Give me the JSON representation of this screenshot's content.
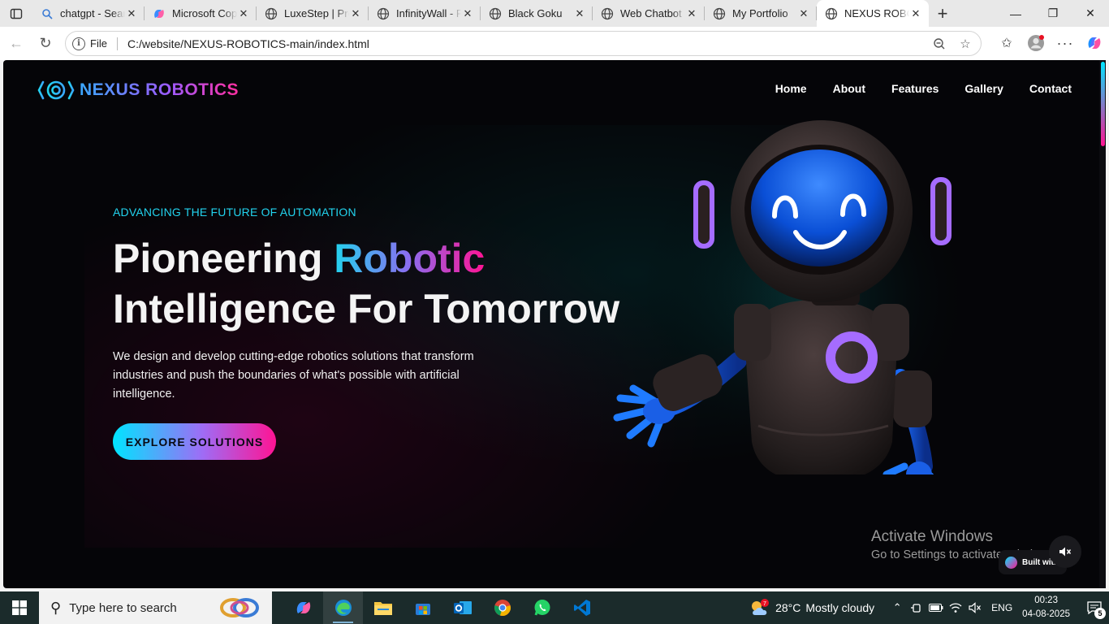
{
  "browser": {
    "tabs": [
      {
        "title": "chatgpt - Search",
        "icon": "search-favicon"
      },
      {
        "title": "Microsoft Copilot",
        "icon": "copilot-favicon"
      },
      {
        "title": "LuxeStep | Premium",
        "icon": "globe-favicon"
      },
      {
        "title": "InfinityWall - Premium",
        "icon": "globe-favicon"
      },
      {
        "title": "Black Goku",
        "icon": "globe-favicon"
      },
      {
        "title": "Web Chatbot",
        "icon": "globe-favicon"
      },
      {
        "title": "My Portfolio",
        "icon": "globe-favicon"
      },
      {
        "title": "NEXUS ROBOTICS",
        "icon": "globe-favicon",
        "active": true
      }
    ],
    "address": {
      "scheme_label": "File",
      "url": "C:/website/NEXUS-ROBOTICS-main/index.html"
    }
  },
  "site": {
    "brand": "NEXUS ROBOTICS",
    "nav": [
      "Home",
      "About",
      "Features",
      "Gallery",
      "Contact"
    ],
    "hero": {
      "eyebrow": "ADVANCING THE FUTURE OF AUTOMATION",
      "headline_part1": "Pioneering ",
      "headline_highlight": "Robotic",
      "headline_line2": "Intelligence For Tomorrow",
      "description": "We design and develop cutting-edge robotics solutions that transform industries and push the boundaries of what's possible with artificial intelligence.",
      "cta": "EXPLORE SOLUTIONS"
    },
    "colors": {
      "accent_cyan": "#22d3ee",
      "accent_purple": "#8b6cf0",
      "accent_pink": "#ff1493",
      "background": "#050508"
    }
  },
  "overlay": {
    "activate_title": "Activate Windows",
    "activate_subtitle": "Go to Settings to activate Windows.",
    "built_with": "Built with"
  },
  "taskbar": {
    "search_placeholder": "Type here to search",
    "apps": [
      "copilot",
      "edge",
      "file-explorer",
      "microsoft-store",
      "outlook",
      "chrome",
      "whatsapp",
      "vscode"
    ],
    "weather": {
      "temp": "28°C",
      "condition": "Mostly cloudy",
      "badge": "7"
    },
    "language": "ENG",
    "time": "00:23",
    "date": "04-08-2025",
    "notifications": "5"
  }
}
